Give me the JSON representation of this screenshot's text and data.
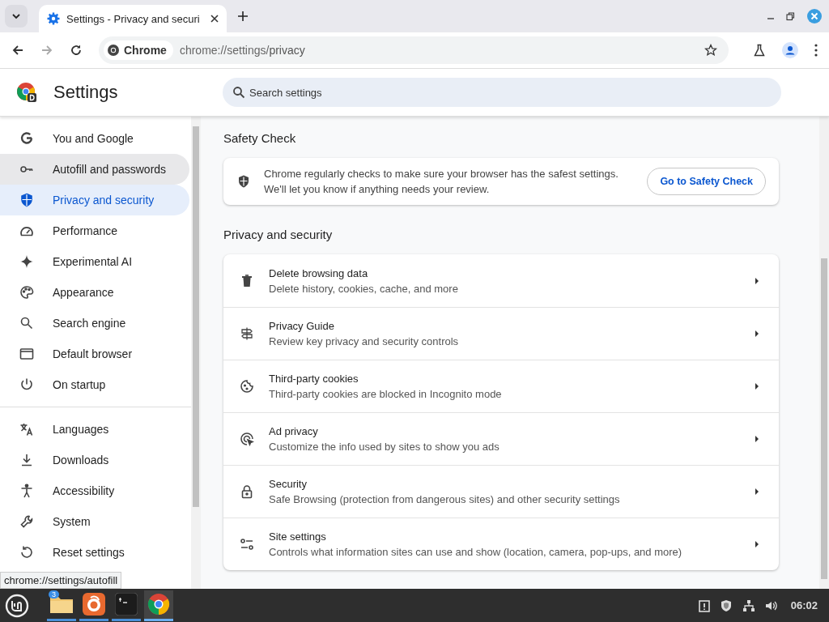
{
  "browser": {
    "tab": {
      "title": "Settings - Privacy and securi",
      "selected": true
    },
    "omnibox": {
      "chip": "Chrome",
      "url_host": "chrome://settings/",
      "url_path": "privacy"
    }
  },
  "header": {
    "title": "Settings",
    "search": {
      "placeholder": "Search settings"
    }
  },
  "sidebar": {
    "items": [
      {
        "label": "You and Google",
        "selected": false,
        "hovered": false
      },
      {
        "label": "Autofill and passwords",
        "selected": false,
        "hovered": true
      },
      {
        "label": "Privacy and security",
        "selected": true,
        "hovered": false
      },
      {
        "label": "Performance",
        "selected": false,
        "hovered": false
      },
      {
        "label": "Experimental AI",
        "selected": false,
        "hovered": false
      },
      {
        "label": "Appearance",
        "selected": false,
        "hovered": false
      },
      {
        "label": "Search engine",
        "selected": false,
        "hovered": false
      },
      {
        "label": "Default browser",
        "selected": false,
        "hovered": false
      },
      {
        "label": "On startup",
        "selected": false,
        "hovered": false
      },
      {
        "label": "Languages",
        "selected": false,
        "hovered": false
      },
      {
        "label": "Downloads",
        "selected": false,
        "hovered": false
      },
      {
        "label": "Accessibility",
        "selected": false,
        "hovered": false
      },
      {
        "label": "System",
        "selected": false,
        "hovered": false
      },
      {
        "label": "Reset settings",
        "selected": false,
        "hovered": false
      }
    ]
  },
  "safety_check": {
    "heading": "Safety Check",
    "text_1": "Chrome regularly checks to make sure your browser has the safest settings.",
    "text_2": "We'll let you know if anything needs your review.",
    "button": "Go to Safety Check"
  },
  "privacy": {
    "heading": "Privacy and security",
    "rows": [
      {
        "title": "Delete browsing data",
        "subtitle": "Delete history, cookies, cache, and more"
      },
      {
        "title": "Privacy Guide",
        "subtitle": "Review key privacy and security controls"
      },
      {
        "title": "Third-party cookies",
        "subtitle": "Third-party cookies are blocked in Incognito mode"
      },
      {
        "title": "Ad privacy",
        "subtitle": "Customize the info used by sites to show you ads"
      },
      {
        "title": "Security",
        "subtitle": "Safe Browsing (protection from dangerous sites) and other security settings"
      },
      {
        "title": "Site settings",
        "subtitle": "Controls what information sites can use and show (location, camera, pop-ups, and more)"
      }
    ]
  },
  "status_tooltip": "chrome://settings/autofill",
  "taskbar": {
    "apps": [
      {
        "kind": "files",
        "badge": "3",
        "active": false
      },
      {
        "kind": "firefox",
        "active": false
      },
      {
        "kind": "terminal",
        "active": false
      },
      {
        "kind": "chrome",
        "active": true
      }
    ],
    "clock": "06:02"
  }
}
